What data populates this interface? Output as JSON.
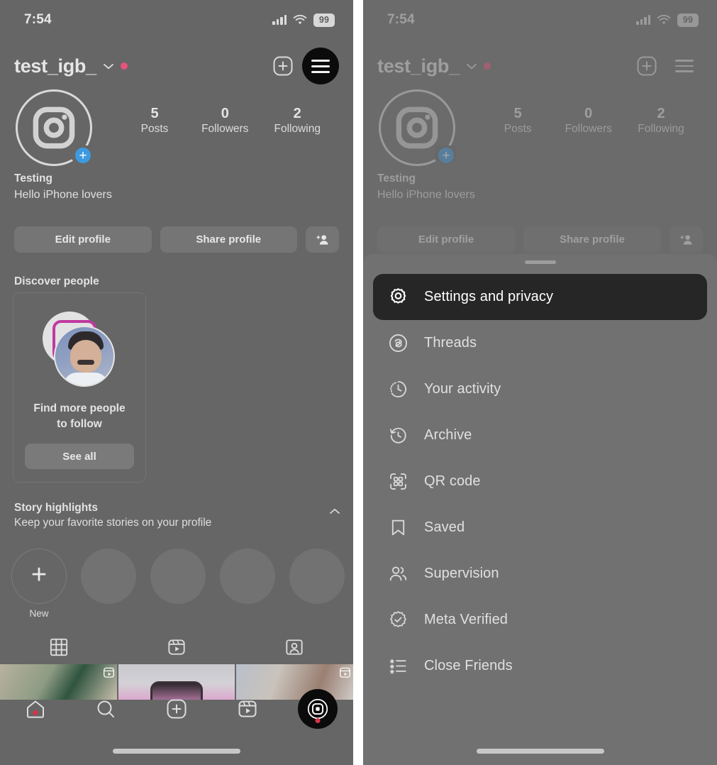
{
  "colors": {
    "screen_bg": "#666666",
    "sheet_bg": "#717171",
    "active_row_bg": "#262626",
    "accent_pink": "#e8527d",
    "accent_blue": "#3e9ae0",
    "notification_red": "#d8334a",
    "text_primary": "#e6e6e6"
  },
  "status_bar": {
    "time": "7:54",
    "battery": "99",
    "signal_icon": "cellular-bars-icon",
    "wifi_icon": "wifi-icon",
    "battery_icon": "battery-icon"
  },
  "profile_header": {
    "username": "test_igb_",
    "chevron_icon": "chevron-down-icon",
    "unread_dot": "pink-dot-icon",
    "new_post_icon": "plus-square-icon",
    "menu_icon": "hamburger-menu-icon"
  },
  "profile": {
    "avatar_icon": "instagram-camera-avatar-icon",
    "add_story_icon": "plus-icon",
    "stats": [
      {
        "value": "5",
        "label": "Posts"
      },
      {
        "value": "0",
        "label": "Followers"
      },
      {
        "value": "2",
        "label": "Following"
      }
    ],
    "full_name": "Testing",
    "bio": "Hello iPhone lovers",
    "actions": {
      "edit_profile": "Edit profile",
      "share_profile": "Share profile",
      "add_person_icon": "add-person-icon"
    }
  },
  "discover": {
    "section_title": "Discover people",
    "card": {
      "avatar_icon": "suggested-user-avatar-icon",
      "caption_line1": "Find more people",
      "caption_line2": "to follow",
      "see_all_label": "See all"
    }
  },
  "story_highlights": {
    "title": "Story highlights",
    "subtitle": "Keep your favorite stories on your profile",
    "collapse_icon": "chevron-up-icon",
    "new_label": "New",
    "placeholder_count": 4
  },
  "content_tabs": [
    {
      "name": "grid-tab",
      "icon": "grid-icon"
    },
    {
      "name": "reels-tab",
      "icon": "reels-icon"
    },
    {
      "name": "tagged-tab",
      "icon": "tagged-person-icon"
    }
  ],
  "post_grid": [
    {
      "name": "post-thumb-1",
      "badge": "reel-badge-icon"
    },
    {
      "name": "post-thumb-2",
      "badge": ""
    },
    {
      "name": "post-thumb-3",
      "badge": "reel-badge-icon"
    }
  ],
  "bottom_nav": [
    {
      "name": "home-tab",
      "icon": "home-icon",
      "badge_dot": true
    },
    {
      "name": "search-tab",
      "icon": "search-icon",
      "badge_dot": false
    },
    {
      "name": "create-tab",
      "icon": "plus-square-icon",
      "badge_dot": false
    },
    {
      "name": "reels-tab",
      "icon": "reels-icon",
      "badge_dot": false
    },
    {
      "name": "profile-tab",
      "icon": "profile-avatar-icon",
      "badge_dot": true
    }
  ],
  "menu_sheet": {
    "grabber": "sheet-grabber-handle",
    "items": [
      {
        "label": "Settings and privacy",
        "icon": "settings-gear-icon",
        "active": true
      },
      {
        "label": "Threads",
        "icon": "threads-icon",
        "active": false
      },
      {
        "label": "Your activity",
        "icon": "your-activity-clock-icon",
        "active": false
      },
      {
        "label": "Archive",
        "icon": "archive-clock-icon",
        "active": false
      },
      {
        "label": "QR code",
        "icon": "qr-code-icon",
        "active": false
      },
      {
        "label": "Saved",
        "icon": "bookmark-icon",
        "active": false
      },
      {
        "label": "Supervision",
        "icon": "supervision-people-icon",
        "active": false
      },
      {
        "label": "Meta Verified",
        "icon": "meta-verified-badge-icon",
        "active": false
      },
      {
        "label": "Close Friends",
        "icon": "close-friends-list-icon",
        "active": false
      }
    ]
  }
}
